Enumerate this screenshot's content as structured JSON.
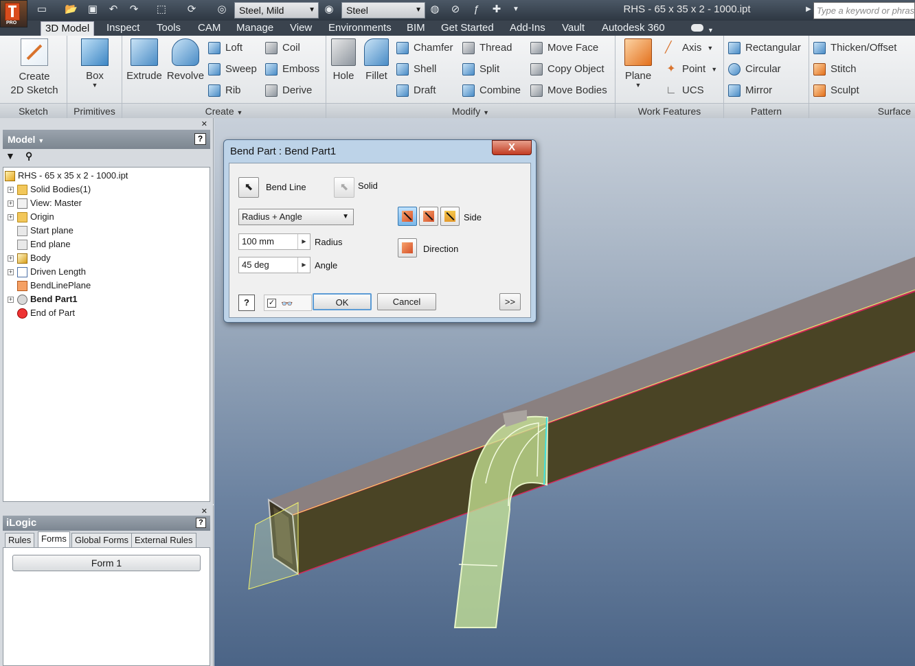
{
  "window": {
    "title": "RHS - 65 x 35 x 2 - 1000.ipt",
    "search_placeholder": "Type a keyword or phrase",
    "material": "Steel, Mild",
    "appearance": "Steel",
    "app_badge": "PRO"
  },
  "tabs": [
    "3D Model",
    "Inspect",
    "Tools",
    "CAM",
    "Manage",
    "View",
    "Environments",
    "BIM",
    "Get Started",
    "Add-Ins",
    "Vault",
    "Autodesk 360"
  ],
  "active_tab": "3D Model",
  "ribbon": {
    "sketch": {
      "label": "Sketch",
      "create_sketch": "Create\n2D Sketch"
    },
    "primitives": {
      "label": "Primitives",
      "box": "Box"
    },
    "create": {
      "label": "Create",
      "extrude": "Extrude",
      "revolve": "Revolve",
      "loft": "Loft",
      "sweep": "Sweep",
      "rib": "Rib",
      "coil": "Coil",
      "emboss": "Emboss",
      "derive": "Derive"
    },
    "modify": {
      "label": "Modify",
      "hole": "Hole",
      "fillet": "Fillet",
      "chamfer": "Chamfer",
      "shell": "Shell",
      "draft": "Draft",
      "thread": "Thread",
      "split": "Split",
      "combine": "Combine",
      "move_face": "Move Face",
      "copy_object": "Copy Object",
      "move_bodies": "Move Bodies"
    },
    "work_features": {
      "label": "Work Features",
      "plane": "Plane",
      "axis": "Axis",
      "point": "Point",
      "ucs": "UCS"
    },
    "pattern": {
      "label": "Pattern",
      "rectangular": "Rectangular",
      "circular": "Circular",
      "mirror": "Mirror"
    },
    "surface": {
      "label": "Surface",
      "thicken": "Thicken/Offset",
      "stitch": "Stitch",
      "sculpt": "Sculpt"
    }
  },
  "browser": {
    "header": "Model",
    "tree": [
      {
        "label": "RHS - 65 x 35 x 2 - 1000.ipt",
        "icon": "part-icon",
        "expander": false,
        "bold": false
      },
      {
        "label": "Solid Bodies(1)",
        "icon": "folder-icon",
        "expander": true,
        "bold": false
      },
      {
        "label": "View: Master",
        "icon": "view-icon",
        "expander": true,
        "bold": false
      },
      {
        "label": "Origin",
        "icon": "folder-icon",
        "expander": true,
        "bold": false
      },
      {
        "label": "Start plane",
        "icon": "plane-icon",
        "expander": false,
        "bold": false
      },
      {
        "label": "End plane",
        "icon": "plane-icon",
        "expander": false,
        "bold": false
      },
      {
        "label": "Body",
        "icon": "body-icon",
        "expander": true,
        "bold": false
      },
      {
        "label": "Driven Length",
        "icon": "parameter-icon",
        "expander": true,
        "bold": false
      },
      {
        "label": "BendLinePlane",
        "icon": "bend-plane-icon",
        "expander": false,
        "bold": false
      },
      {
        "label": "Bend Part1",
        "icon": "bend-icon",
        "expander": true,
        "bold": true
      },
      {
        "label": "End of Part",
        "icon": "end-of-part-icon",
        "expander": false,
        "bold": false
      }
    ]
  },
  "ilogic": {
    "header": "iLogic",
    "tabs": [
      "Rules",
      "Forms",
      "Global Forms",
      "External Rules"
    ],
    "active_tab": "Forms",
    "form_button": "Form 1"
  },
  "dialog": {
    "title": "Bend Part : Bend Part1",
    "bend_line_label": "Bend Line",
    "solid_label": "Solid",
    "method": "Radius + Angle",
    "radius_value": "100 mm",
    "radius_label": "Radius",
    "angle_value": "45 deg",
    "angle_label": "Angle",
    "side_label": "Side",
    "direction_label": "Direction",
    "ok": "OK",
    "cancel": "Cancel",
    "more": ">>",
    "help": "?",
    "close": "X"
  },
  "colors": {
    "tube_face": "#4a4425",
    "tube_top": "#857b78",
    "highlight": "#d7f0a8",
    "edge_yellow": "#f2f26b",
    "edge_red": "#d2285a"
  }
}
